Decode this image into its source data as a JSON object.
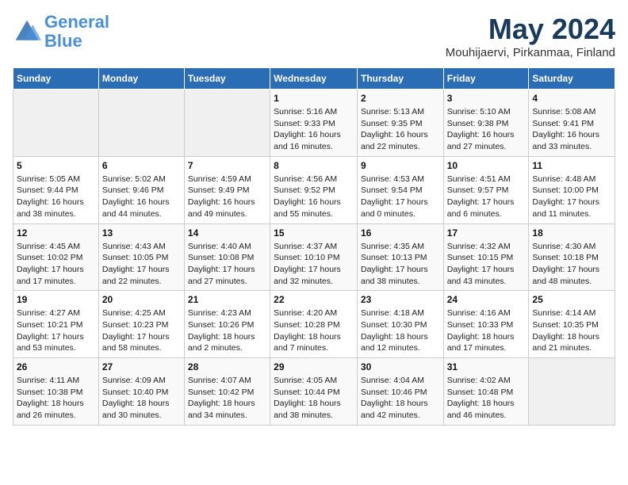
{
  "logo": {
    "line1": "General",
    "line2": "Blue"
  },
  "title": "May 2024",
  "location": "Mouhijaervi, Pirkanmaa, Finland",
  "days_of_week": [
    "Sunday",
    "Monday",
    "Tuesday",
    "Wednesday",
    "Thursday",
    "Friday",
    "Saturday"
  ],
  "weeks": [
    [
      {
        "day": "",
        "info": ""
      },
      {
        "day": "",
        "info": ""
      },
      {
        "day": "",
        "info": ""
      },
      {
        "day": "1",
        "info": "Sunrise: 5:16 AM\nSunset: 9:33 PM\nDaylight: 16 hours\nand 16 minutes."
      },
      {
        "day": "2",
        "info": "Sunrise: 5:13 AM\nSunset: 9:35 PM\nDaylight: 16 hours\nand 22 minutes."
      },
      {
        "day": "3",
        "info": "Sunrise: 5:10 AM\nSunset: 9:38 PM\nDaylight: 16 hours\nand 27 minutes."
      },
      {
        "day": "4",
        "info": "Sunrise: 5:08 AM\nSunset: 9:41 PM\nDaylight: 16 hours\nand 33 minutes."
      }
    ],
    [
      {
        "day": "5",
        "info": "Sunrise: 5:05 AM\nSunset: 9:44 PM\nDaylight: 16 hours\nand 38 minutes."
      },
      {
        "day": "6",
        "info": "Sunrise: 5:02 AM\nSunset: 9:46 PM\nDaylight: 16 hours\nand 44 minutes."
      },
      {
        "day": "7",
        "info": "Sunrise: 4:59 AM\nSunset: 9:49 PM\nDaylight: 16 hours\nand 49 minutes."
      },
      {
        "day": "8",
        "info": "Sunrise: 4:56 AM\nSunset: 9:52 PM\nDaylight: 16 hours\nand 55 minutes."
      },
      {
        "day": "9",
        "info": "Sunrise: 4:53 AM\nSunset: 9:54 PM\nDaylight: 17 hours\nand 0 minutes."
      },
      {
        "day": "10",
        "info": "Sunrise: 4:51 AM\nSunset: 9:57 PM\nDaylight: 17 hours\nand 6 minutes."
      },
      {
        "day": "11",
        "info": "Sunrise: 4:48 AM\nSunset: 10:00 PM\nDaylight: 17 hours\nand 11 minutes."
      }
    ],
    [
      {
        "day": "12",
        "info": "Sunrise: 4:45 AM\nSunset: 10:02 PM\nDaylight: 17 hours\nand 17 minutes."
      },
      {
        "day": "13",
        "info": "Sunrise: 4:43 AM\nSunset: 10:05 PM\nDaylight: 17 hours\nand 22 minutes."
      },
      {
        "day": "14",
        "info": "Sunrise: 4:40 AM\nSunset: 10:08 PM\nDaylight: 17 hours\nand 27 minutes."
      },
      {
        "day": "15",
        "info": "Sunrise: 4:37 AM\nSunset: 10:10 PM\nDaylight: 17 hours\nand 32 minutes."
      },
      {
        "day": "16",
        "info": "Sunrise: 4:35 AM\nSunset: 10:13 PM\nDaylight: 17 hours\nand 38 minutes."
      },
      {
        "day": "17",
        "info": "Sunrise: 4:32 AM\nSunset: 10:15 PM\nDaylight: 17 hours\nand 43 minutes."
      },
      {
        "day": "18",
        "info": "Sunrise: 4:30 AM\nSunset: 10:18 PM\nDaylight: 17 hours\nand 48 minutes."
      }
    ],
    [
      {
        "day": "19",
        "info": "Sunrise: 4:27 AM\nSunset: 10:21 PM\nDaylight: 17 hours\nand 53 minutes."
      },
      {
        "day": "20",
        "info": "Sunrise: 4:25 AM\nSunset: 10:23 PM\nDaylight: 17 hours\nand 58 minutes."
      },
      {
        "day": "21",
        "info": "Sunrise: 4:23 AM\nSunset: 10:26 PM\nDaylight: 18 hours\nand 2 minutes."
      },
      {
        "day": "22",
        "info": "Sunrise: 4:20 AM\nSunset: 10:28 PM\nDaylight: 18 hours\nand 7 minutes."
      },
      {
        "day": "23",
        "info": "Sunrise: 4:18 AM\nSunset: 10:30 PM\nDaylight: 18 hours\nand 12 minutes."
      },
      {
        "day": "24",
        "info": "Sunrise: 4:16 AM\nSunset: 10:33 PM\nDaylight: 18 hours\nand 17 minutes."
      },
      {
        "day": "25",
        "info": "Sunrise: 4:14 AM\nSunset: 10:35 PM\nDaylight: 18 hours\nand 21 minutes."
      }
    ],
    [
      {
        "day": "26",
        "info": "Sunrise: 4:11 AM\nSunset: 10:38 PM\nDaylight: 18 hours\nand 26 minutes."
      },
      {
        "day": "27",
        "info": "Sunrise: 4:09 AM\nSunset: 10:40 PM\nDaylight: 18 hours\nand 30 minutes."
      },
      {
        "day": "28",
        "info": "Sunrise: 4:07 AM\nSunset: 10:42 PM\nDaylight: 18 hours\nand 34 minutes."
      },
      {
        "day": "29",
        "info": "Sunrise: 4:05 AM\nSunset: 10:44 PM\nDaylight: 18 hours\nand 38 minutes."
      },
      {
        "day": "30",
        "info": "Sunrise: 4:04 AM\nSunset: 10:46 PM\nDaylight: 18 hours\nand 42 minutes."
      },
      {
        "day": "31",
        "info": "Sunrise: 4:02 AM\nSunset: 10:48 PM\nDaylight: 18 hours\nand 46 minutes."
      },
      {
        "day": "",
        "info": ""
      }
    ]
  ]
}
